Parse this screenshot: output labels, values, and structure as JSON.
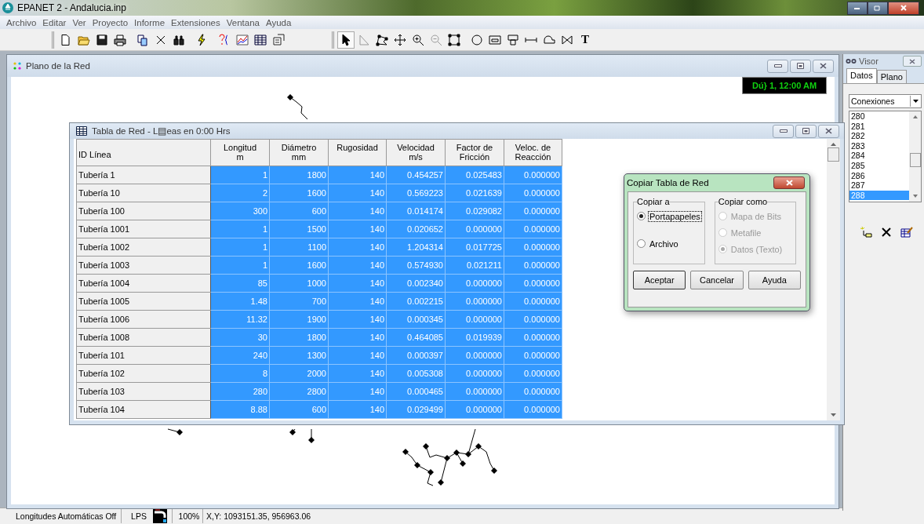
{
  "window": {
    "title": "EPANET 2 - Andalucia.inp"
  },
  "menu": [
    "Archivo",
    "Editar",
    "Ver",
    "Proyecto",
    "Informe",
    "Extensiones",
    "Ventana",
    "Ayuda"
  ],
  "toolbar": {
    "text_tool": "T"
  },
  "map_window": {
    "title": "Plano de la Red",
    "clock": "Dú} 1, 12:00 AM"
  },
  "table_window": {
    "title": "Tabla de Red - L▤eas en 0:00 Hrs",
    "columns": [
      {
        "lines": [
          "ID Línea"
        ]
      },
      {
        "lines": [
          "Longitud",
          "m"
        ]
      },
      {
        "lines": [
          "Diámetro",
          "mm"
        ]
      },
      {
        "lines": [
          "Rugosidad"
        ]
      },
      {
        "lines": [
          "Velocidad",
          "m/s"
        ]
      },
      {
        "lines": [
          "Factor de",
          "Fricción"
        ]
      },
      {
        "lines": [
          "Veloc. de",
          "Reacción"
        ]
      }
    ],
    "rows": [
      {
        "cells": [
          "Tubería 1",
          "1",
          "1800",
          "140",
          "0.454257",
          "0.025483",
          "0.000000"
        ],
        "selected": true
      },
      {
        "cells": [
          "Tubería 10",
          "2",
          "1600",
          "140",
          "0.569223",
          "0.021639",
          "0.000000"
        ],
        "selected": true
      },
      {
        "cells": [
          "Tubería 100",
          "300",
          "600",
          "140",
          "0.014174",
          "0.029082",
          "0.000000"
        ],
        "selected": true
      },
      {
        "cells": [
          "Tubería 1001",
          "1",
          "1500",
          "140",
          "0.020652",
          "0.000000",
          "0.000000"
        ],
        "selected": true
      },
      {
        "cells": [
          "Tubería 1002",
          "1",
          "1100",
          "140",
          "1.204314",
          "0.017725",
          "0.000000"
        ],
        "selected": true
      },
      {
        "cells": [
          "Tubería 1003",
          "1",
          "1600",
          "140",
          "0.574930",
          "0.021211",
          "0.000000"
        ],
        "selected": true
      },
      {
        "cells": [
          "Tubería 1004",
          "85",
          "1000",
          "140",
          "0.002340",
          "0.000000",
          "0.000000"
        ],
        "selected": true
      },
      {
        "cells": [
          "Tubería 1005",
          "1.48",
          "700",
          "140",
          "0.002215",
          "0.000000",
          "0.000000"
        ],
        "selected": true
      },
      {
        "cells": [
          "Tubería 1006",
          "11.32",
          "1900",
          "140",
          "0.000345",
          "0.000000",
          "0.000000"
        ],
        "selected": true
      },
      {
        "cells": [
          "Tubería 1008",
          "30",
          "1800",
          "140",
          "0.464085",
          "0.019939",
          "0.000000"
        ],
        "selected": true
      },
      {
        "cells": [
          "Tubería 101",
          "240",
          "1300",
          "140",
          "0.000397",
          "0.000000",
          "0.000000"
        ],
        "selected": true
      },
      {
        "cells": [
          "Tubería 102",
          "8",
          "2000",
          "140",
          "0.005308",
          "0.000000",
          "0.000000"
        ],
        "selected": true
      },
      {
        "cells": [
          "Tubería 103",
          "280",
          "2800",
          "140",
          "0.000465",
          "0.000000",
          "0.000000"
        ],
        "selected": true
      },
      {
        "cells": [
          "Tubería 104",
          "8.88",
          "600",
          "140",
          "0.029499",
          "0.000000",
          "0.000000"
        ],
        "selected": true
      }
    ]
  },
  "dialog": {
    "title": "Copiar Tabla de Red",
    "copy_to": {
      "label": "Copiar a",
      "options": [
        {
          "label": "Portapapeles",
          "selected": true,
          "disabled": false
        },
        {
          "label": "Archivo",
          "selected": false,
          "disabled": false
        }
      ]
    },
    "copy_as": {
      "label": "Copiar como",
      "options": [
        {
          "label": "Mapa de Bits",
          "selected": false,
          "disabled": true
        },
        {
          "label": "Metafile",
          "selected": false,
          "disabled": true
        },
        {
          "label": "Datos (Texto)",
          "selected": true,
          "disabled": true
        }
      ]
    },
    "buttons": [
      "Aceptar",
      "Cancelar",
      "Ayuda"
    ]
  },
  "browser": {
    "title": "Visor",
    "tabs": [
      {
        "label": "Datos",
        "selected": true
      },
      {
        "label": "Plano",
        "selected": false
      }
    ],
    "category": "Conexiones",
    "items": [
      {
        "label": "280",
        "selected": false
      },
      {
        "label": "281",
        "selected": false
      },
      {
        "label": "282",
        "selected": false
      },
      {
        "label": "283",
        "selected": false
      },
      {
        "label": "284",
        "selected": false
      },
      {
        "label": "285",
        "selected": false
      },
      {
        "label": "286",
        "selected": false
      },
      {
        "label": "287",
        "selected": false
      },
      {
        "label": "288",
        "selected": true
      }
    ]
  },
  "status_bar": {
    "auto_length": "Longitudes Automáticas Off",
    "units": "LPS",
    "zoom": "100%",
    "coordinates": "X,Y: 1093151.35, 956963.06"
  }
}
